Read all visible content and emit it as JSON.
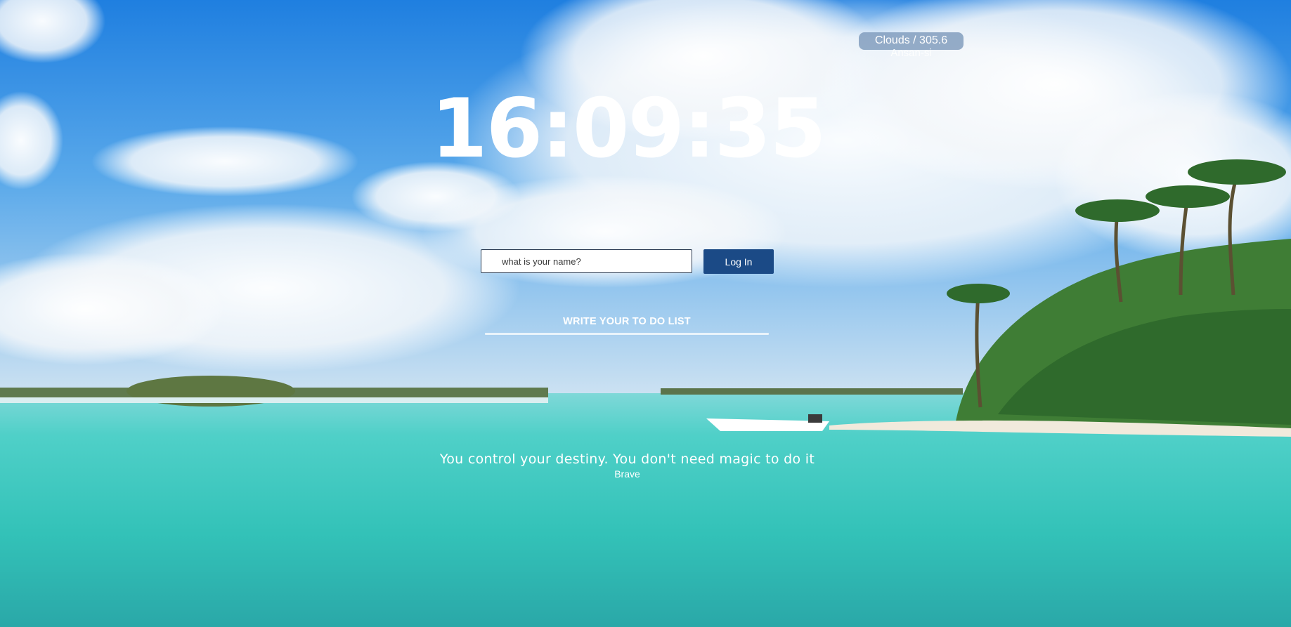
{
  "weather": {
    "summary": "Clouds / 305.6",
    "city": "Ansan-si"
  },
  "clock": {
    "time": "16:09:35"
  },
  "login": {
    "placeholder": "what is your name?",
    "button_label": "Log In"
  },
  "todo": {
    "label": "WRITE YOUR TO DO LIST"
  },
  "quote": {
    "text": "You control your destiny. You don't need magic to do it",
    "author": "Brave"
  },
  "colors": {
    "button": "#1b4a86",
    "sky": "#2f86dd",
    "sea": "#38c7c0"
  }
}
